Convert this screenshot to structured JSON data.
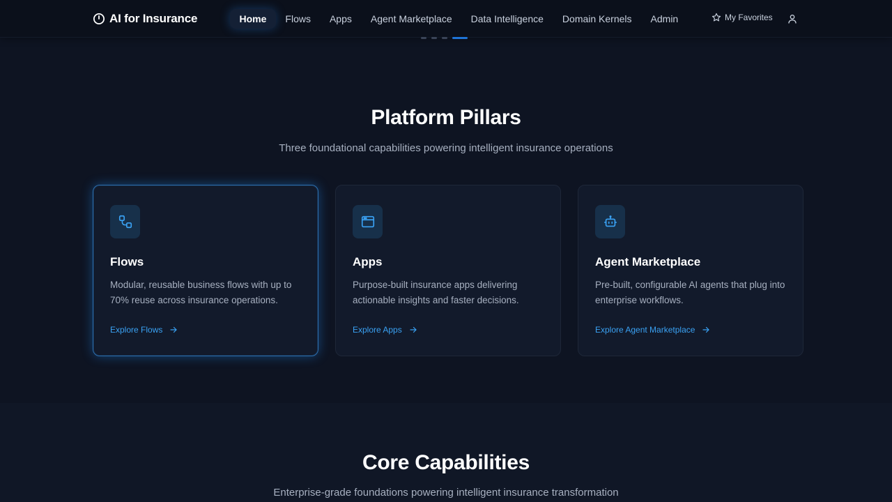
{
  "brand": {
    "name": "AI for Insurance",
    "icon": "power-icon"
  },
  "nav": {
    "items": [
      {
        "label": "Home",
        "active": true
      },
      {
        "label": "Flows",
        "active": false
      },
      {
        "label": "Apps",
        "active": false
      },
      {
        "label": "Agent Marketplace",
        "active": false
      },
      {
        "label": "Data Intelligence",
        "active": false
      },
      {
        "label": "Domain Kernels",
        "active": false
      },
      {
        "label": "Admin",
        "active": false
      }
    ],
    "favorites_label": "My Favorites",
    "favorites_icon": "star-icon",
    "user_icon": "user-icon"
  },
  "carousel": {
    "slide_count": 4,
    "active_slide": 4
  },
  "pillars": {
    "title": "Platform Pillars",
    "subtitle": "Three foundational capabilities powering intelligent insurance operations",
    "cards": [
      {
        "icon": "workflow-icon",
        "title": "Flows",
        "description": "Modular, reusable business flows with up to 70% reuse across insurance operations.",
        "link": "Explore Flows",
        "highlighted": true
      },
      {
        "icon": "app-window-icon",
        "title": "Apps",
        "description": "Purpose-built insurance apps delivering actionable insights and faster decisions.",
        "link": "Explore Apps",
        "highlighted": false
      },
      {
        "icon": "bot-icon",
        "title": "Agent Marketplace",
        "description": "Pre-built, configurable AI agents that plug into enterprise workflows.",
        "link": "Explore Agent Marketplace",
        "highlighted": false
      }
    ]
  },
  "core": {
    "title": "Core Capabilities",
    "subtitle": "Enterprise-grade foundations powering intelligent insurance transformation"
  },
  "colors": {
    "background": "#0e1422",
    "nav_background": "#0b101b",
    "card_background": "#121a2b",
    "accent": "#3aa2f4",
    "icon_tile": "#17304a"
  }
}
